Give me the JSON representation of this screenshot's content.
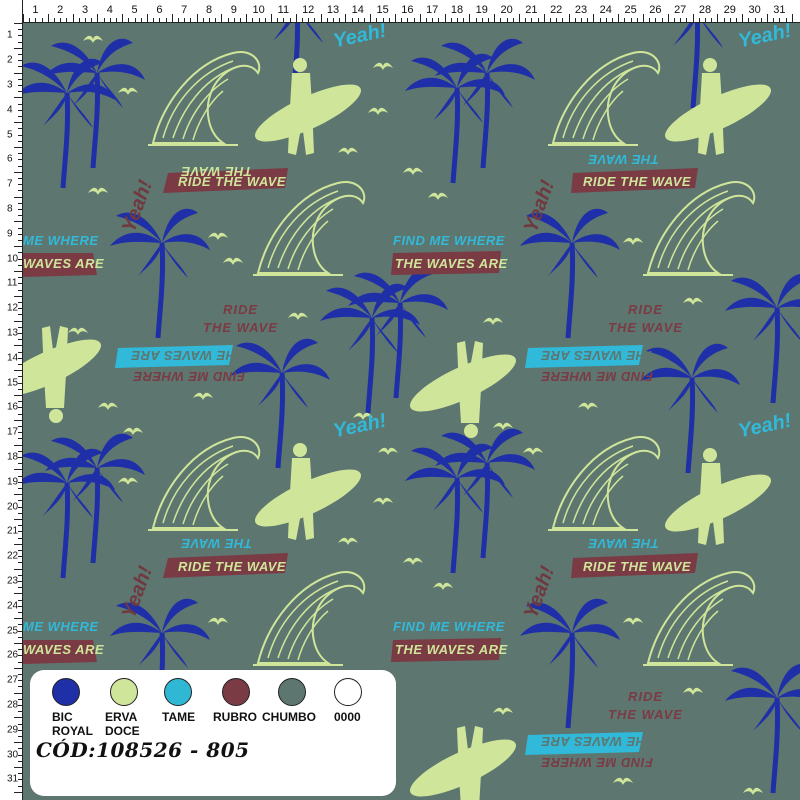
{
  "ruler": {
    "top_numbers": [
      "1",
      "2",
      "3",
      "4",
      "5",
      "6",
      "7",
      "8",
      "9",
      "10",
      "11",
      "12",
      "13",
      "14",
      "15",
      "16",
      "17",
      "18",
      "19",
      "20",
      "21",
      "22",
      "23",
      "24",
      "25",
      "26",
      "27",
      "28",
      "29",
      "30",
      "31"
    ],
    "left_numbers": [
      "1",
      "2",
      "3",
      "4",
      "5",
      "6",
      "7",
      "8",
      "9",
      "10",
      "11",
      "12",
      "13",
      "14",
      "15",
      "16",
      "17",
      "18",
      "19",
      "20",
      "21",
      "22",
      "23",
      "24",
      "25",
      "26",
      "27",
      "28",
      "29",
      "30",
      "31"
    ]
  },
  "pattern": {
    "background": "#5e7670",
    "texts": {
      "yeah": "Yeah!",
      "ride_line1": "RIDE",
      "ride_line2": "THE WAVE",
      "ride_the_wave": "RIDE THE WAVE",
      "find_me_where": "FIND ME WHERE",
      "the_waves_are": "THE WAVES ARE",
      "me_where": "ME WHERE",
      "waves_are": "WAVES ARE"
    },
    "motifs": [
      "palm-tree",
      "surfer-with-board",
      "ocean-wave",
      "seagull"
    ]
  },
  "legend": {
    "colors": [
      {
        "name": "BIC\nROYAL",
        "hex": "#1f2fa8"
      },
      {
        "name": "ERVA\nDOCE",
        "hex": "#cfe69a"
      },
      {
        "name": "TAME",
        "hex": "#2fb7d3"
      },
      {
        "name": "RUBRO",
        "hex": "#7a3b45"
      },
      {
        "name": "CHUMBO",
        "hex": "#5e7670"
      },
      {
        "name": "0000",
        "hex": "#ffffff"
      }
    ],
    "code": "CÓD:108526 - 805"
  }
}
